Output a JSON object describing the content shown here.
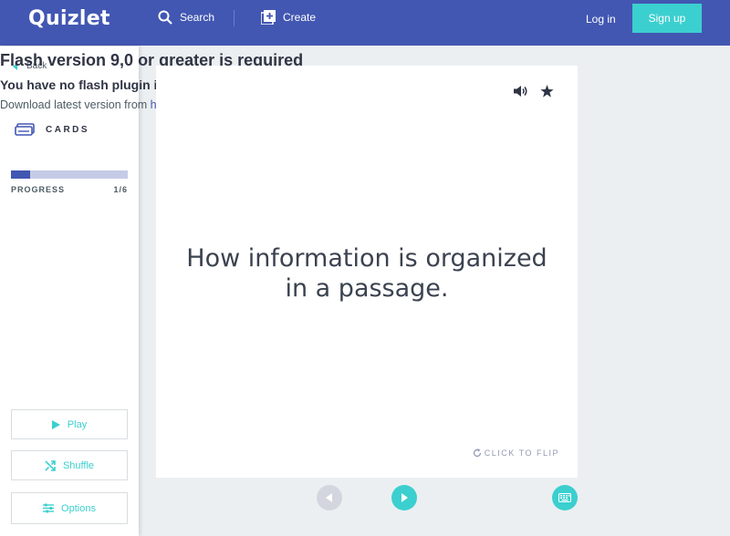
{
  "nav": {
    "logo": "Quizlet",
    "search_label": "Search",
    "create_label": "Create",
    "login_label": "Log in",
    "signup_label": "Sign up"
  },
  "flash_notice": {
    "title": "Flash version 9,0 or greater is required",
    "subtitle": "You have no flash plugin installed",
    "download_text": "Download latest version from ",
    "download_link": "here"
  },
  "sidebar": {
    "back_label": "Back",
    "mode_label": "CARDS",
    "progress_label": "PROGRESS",
    "progress_count": "1/6",
    "progress_fraction": 0.1667,
    "play_label": "Play",
    "shuffle_label": "Shuffle",
    "options_label": "Options"
  },
  "card": {
    "term": "How information is organized in a passage.",
    "flip_hint": "CLICK TO FLIP"
  },
  "icons": {
    "search": "search-icon",
    "create": "create-icon",
    "cards": "cards-icon",
    "play": "play-icon",
    "shuffle": "shuffle-icon",
    "options": "options-icon",
    "audio": "audio-icon",
    "star": "star-icon",
    "flip": "flip-icon",
    "prev": "prev-arrow-icon",
    "next": "next-arrow-icon",
    "keyboard": "keyboard-icon"
  },
  "colors": {
    "brand": "#4257b2",
    "accent": "#3ccfcf"
  }
}
